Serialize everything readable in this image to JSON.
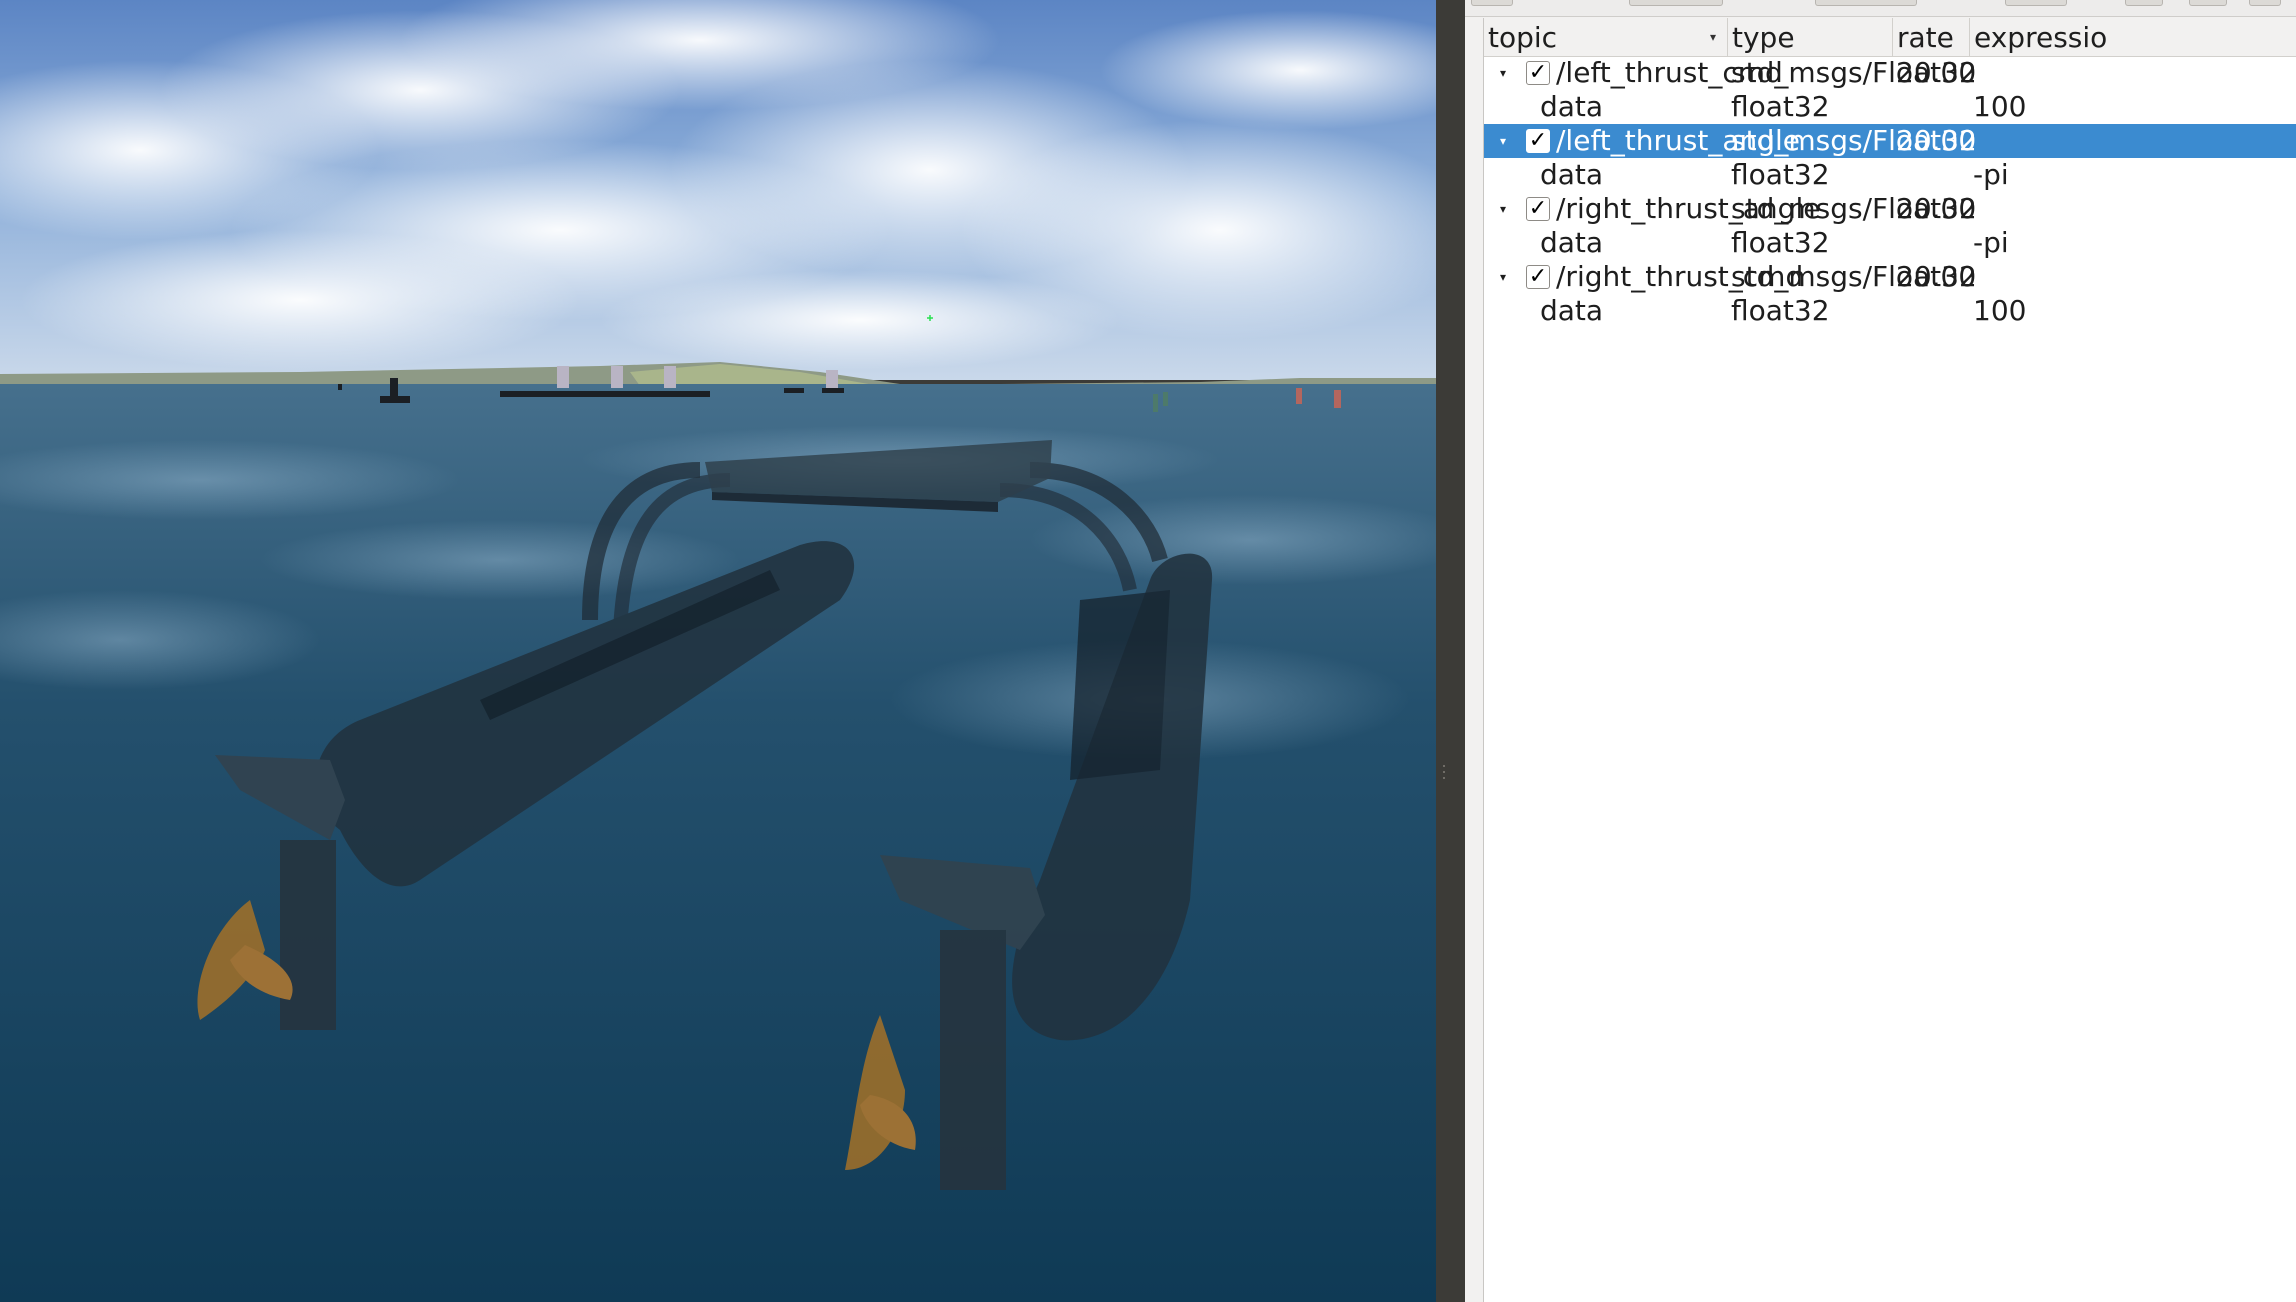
{
  "panel": {
    "columns": [
      "topic",
      "type",
      "rate",
      "expressio"
    ],
    "rows": [
      {
        "kind": "topic",
        "expanded": true,
        "checked": "✓",
        "topic": "/left_thrust_cmd",
        "type": "std_msgs/Float32",
        "rate": "20.00",
        "expression": "",
        "selected": false
      },
      {
        "kind": "field",
        "topic": "data",
        "type": "float32",
        "rate": "",
        "expression": "100"
      },
      {
        "kind": "topic",
        "expanded": true,
        "checked": "✓",
        "topic": "/left_thrust_angle",
        "type": "std_msgs/Float32",
        "rate": "20.00",
        "expression": "",
        "selected": true
      },
      {
        "kind": "field",
        "topic": "data",
        "type": "float32",
        "rate": "",
        "expression": "-pi"
      },
      {
        "kind": "topic",
        "expanded": true,
        "checked": "✓",
        "topic": "/right_thrust_angle",
        "type": "std_msgs/Float32",
        "rate": "20.00",
        "expression": "",
        "selected": false
      },
      {
        "kind": "field",
        "topic": "data",
        "type": "float32",
        "rate": "",
        "expression": "-pi"
      },
      {
        "kind": "topic",
        "expanded": true,
        "checked": "✓",
        "topic": "/right_thrust_cmd",
        "type": "std_msgs/Float32",
        "rate": "20.00",
        "expression": "",
        "selected": false
      },
      {
        "kind": "field",
        "topic": "data",
        "type": "float32",
        "rate": "",
        "expression": "100"
      }
    ],
    "expand_icon": "▾",
    "sort_icon": "▾"
  },
  "colors": {
    "selection": "#3b8bd0",
    "sky_top": "#5f86c2",
    "water_deep": "#12405c",
    "hull": "#25343f"
  }
}
